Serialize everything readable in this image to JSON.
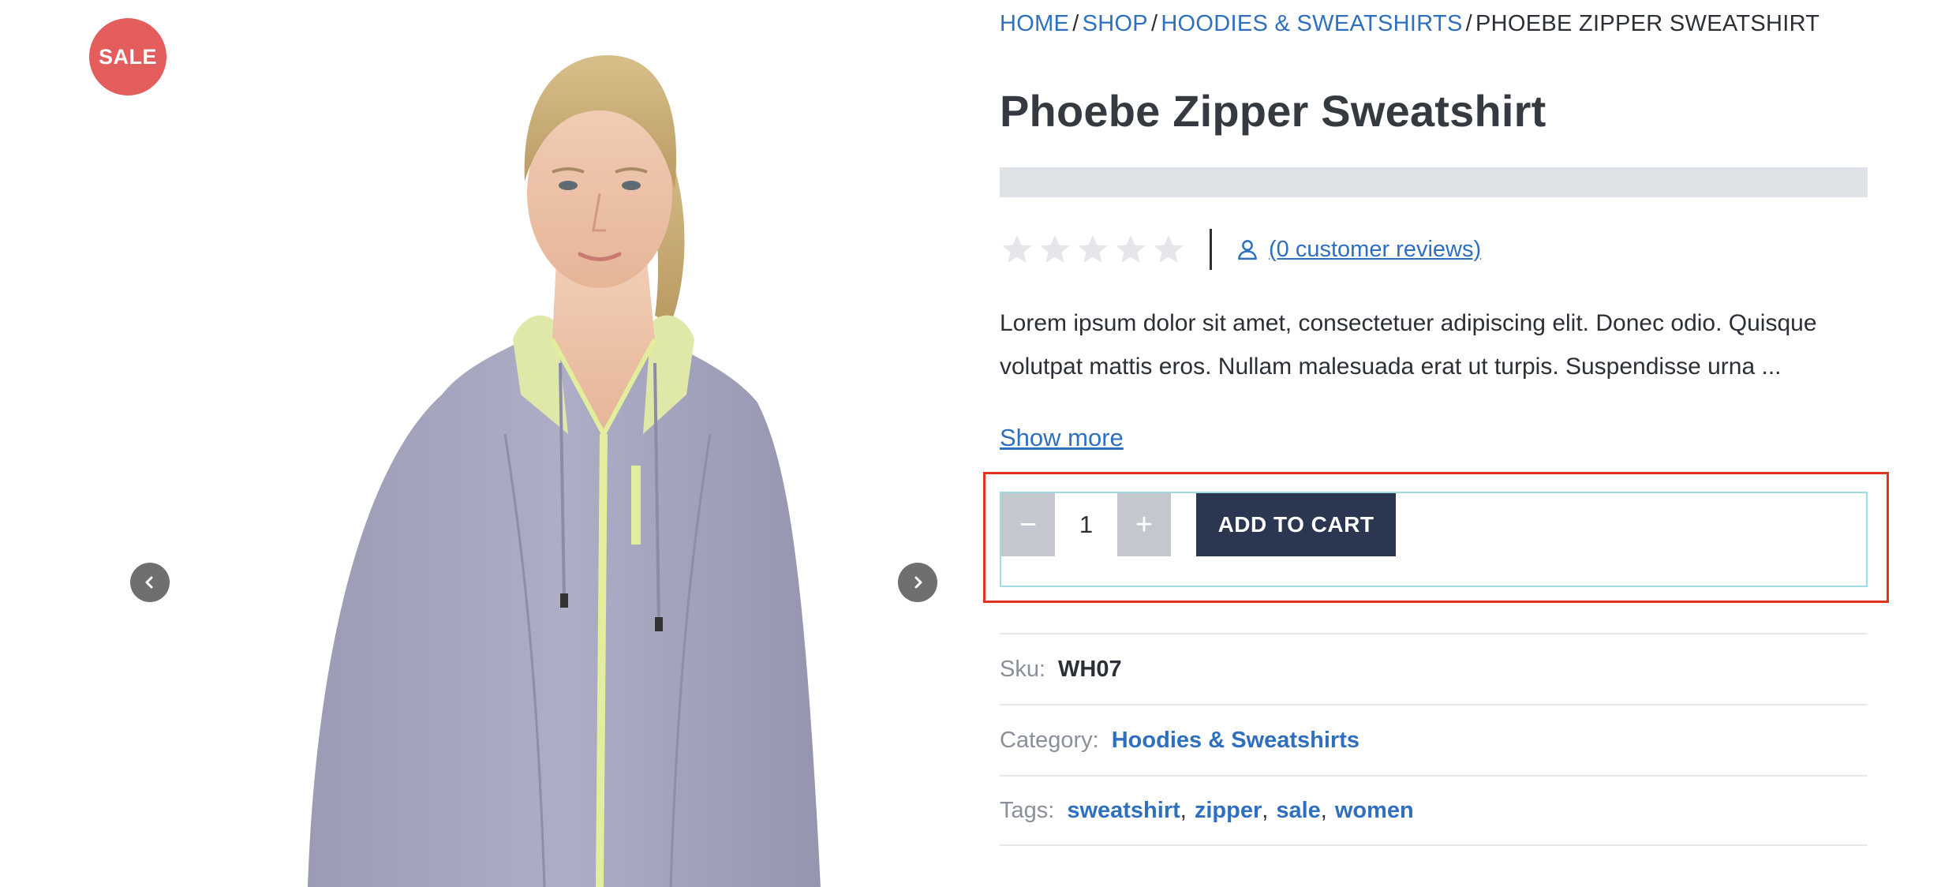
{
  "gallery": {
    "sale_badge": "SALE",
    "prev_arrow_icon": "chevron-left-icon",
    "next_arrow_icon": "chevron-right-icon",
    "image_subject": "woman wearing lavender zip-up hoodie"
  },
  "breadcrumb": {
    "items": [
      "HOME",
      "SHOP",
      "HOODIES & SWEATSHIRTS"
    ],
    "current": "PHOEBE ZIPPER SWEATSHIRT",
    "separator": "/"
  },
  "product": {
    "title": "Phoebe Zipper Sweatshirt",
    "rating": {
      "value": 0,
      "max": 5
    },
    "reviews_link": "(0 customer reviews)",
    "description": "Lorem ipsum dolor sit amet, consectetuer adipiscing elit. Donec odio. Quisque volutpat mattis eros. Nullam malesuada erat ut turpis. Suspendisse urna ...",
    "show_more": "Show more"
  },
  "cart": {
    "decrement_label": "−",
    "quantity": "1",
    "increment_label": "+",
    "add_to_cart": "ADD TO CART"
  },
  "meta": {
    "sku_label": "Sku:",
    "sku_value": "WH07",
    "category_label": "Category:",
    "category_value": "Hoodies & Sweatshirts",
    "tags_label": "Tags:",
    "tags": [
      "sweatshirt",
      "zipper",
      "sale",
      "women"
    ]
  },
  "colors": {
    "link": "#2f6fc0",
    "sale_badge": "#e35d5d",
    "add_to_cart_bg": "#2b3651",
    "highlight_border": "#e0341f",
    "form_border": "#9fdbe0"
  }
}
